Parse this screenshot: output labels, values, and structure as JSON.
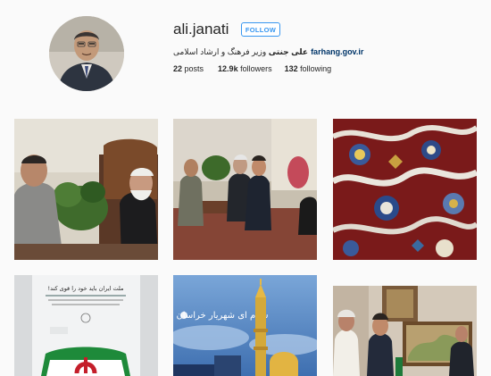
{
  "profile": {
    "username": "ali.janati",
    "follow_label": "FOLLOW",
    "bio_name": "علی جنتی",
    "bio_text": "وزیر فرهنگ و ارشاد اسلامی",
    "bio_link": "farhang.gov.ir",
    "stats": {
      "posts_count": "22",
      "posts_label": "posts",
      "followers_count": "12.9k",
      "followers_label": "followers",
      "following_count": "132",
      "following_label": "following"
    }
  },
  "posts": {
    "post4_caption": "ملت ایران باید خود را قوی کند!",
    "post5_caption": "سلام ای شهریار خراسان"
  },
  "colors": {
    "accent": "#3897f0",
    "link": "#003569",
    "background": "#fafafa"
  }
}
